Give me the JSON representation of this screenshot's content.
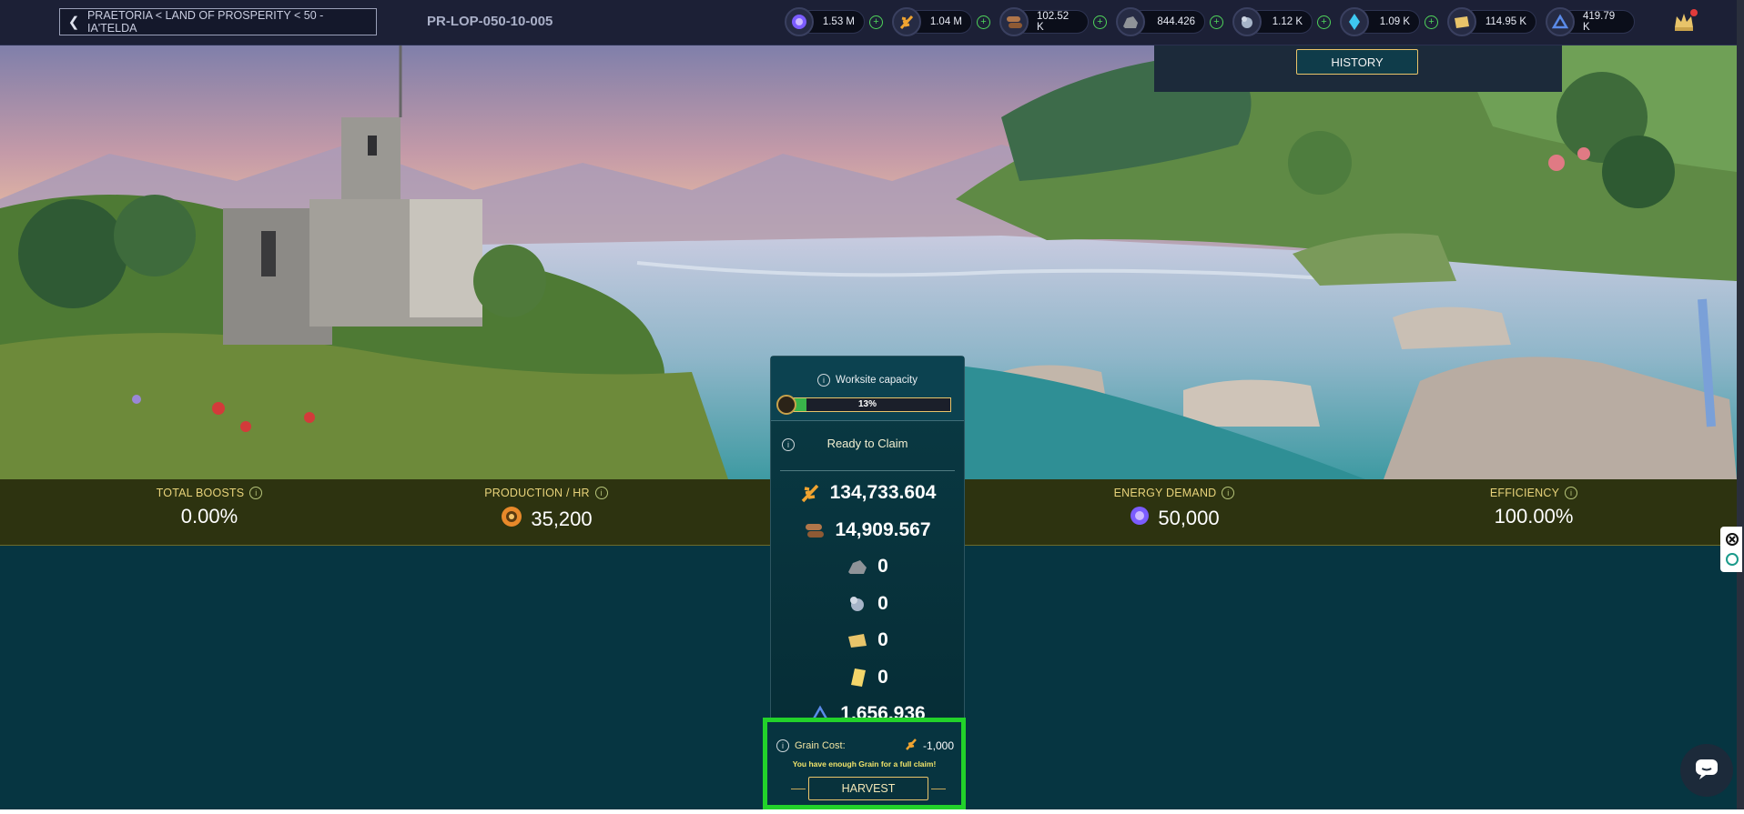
{
  "header": {
    "breadcrumb": "PRAETORIA < LAND OF PROSPERITY < 50 - IA'TELDA",
    "plot_id": "PR-LOP-050-10-005",
    "resources": [
      {
        "icon": "energy-icon",
        "value": "1.53 M",
        "color": "#7b5cff"
      },
      {
        "icon": "grain-icon",
        "value": "1.04 M",
        "color": "#f0a330"
      },
      {
        "icon": "wood-icon",
        "value": "102.52 K",
        "color": "#b0764a"
      },
      {
        "icon": "stone-icon",
        "value": "844.426",
        "color": "#8f9398"
      },
      {
        "icon": "iron-icon",
        "value": "1.12 K",
        "color": "#a6b4c8"
      },
      {
        "icon": "crystal-icon",
        "value": "1.09 K",
        "color": "#3ec8f0"
      },
      {
        "icon": "scroll-icon",
        "value": "114.95 K",
        "color": "#e8c46a"
      },
      {
        "icon": "research-icon",
        "value": "419.79 K",
        "color": "#5a8ae8"
      }
    ]
  },
  "history_label": "HISTORY",
  "stats": {
    "total_boosts": {
      "label": "TOTAL BOOSTS",
      "value": "0.00%"
    },
    "production": {
      "label": "PRODUCTION / HR",
      "value": "35,200"
    },
    "energy_demand": {
      "label": "ENERGY DEMAND",
      "value": "50,000"
    },
    "efficiency": {
      "label": "EFFICIENCY",
      "value": "100.00%"
    }
  },
  "claim": {
    "capacity_label": "Worksite capacity",
    "capacity_percent": 13,
    "capacity_text": "13%",
    "ready_label": "Ready to Claim",
    "items": [
      {
        "icon": "grain-icon",
        "value": "134,733.604"
      },
      {
        "icon": "wood-icon",
        "value": "14,909.567"
      },
      {
        "icon": "stone-icon",
        "value": "0"
      },
      {
        "icon": "iron-icon",
        "value": "0"
      },
      {
        "icon": "scroll-icon",
        "value": "0"
      },
      {
        "icon": "card-icon",
        "value": "0"
      },
      {
        "icon": "research-icon",
        "value": "1,656.936"
      }
    ],
    "cost_label": "Grain Cost:",
    "cost_value": "-1,000",
    "cost_message": "You have enough Grain for a full claim!",
    "harvest_label": "HARVEST"
  },
  "colors": {
    "accent_gold": "#e9c46a",
    "highlight_green": "#22d22a",
    "progress_green": "#39b54a"
  }
}
